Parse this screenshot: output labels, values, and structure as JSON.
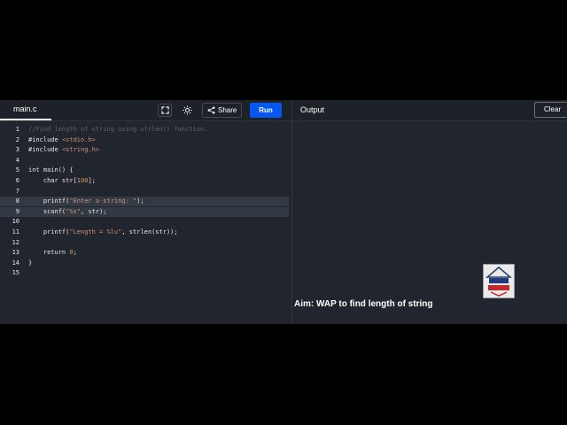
{
  "editor": {
    "file_tab": "main.c",
    "lines": [
      {
        "n": "1",
        "text": "//Find length of string using strlen() function."
      },
      {
        "n": "2",
        "text": "#include <stdio.h>"
      },
      {
        "n": "3",
        "text": "#include <string.h>"
      },
      {
        "n": "4",
        "text": ""
      },
      {
        "n": "5",
        "text": "int main() {"
      },
      {
        "n": "6",
        "text": "    char str[100];"
      },
      {
        "n": "7",
        "text": ""
      },
      {
        "n": "8",
        "text": "    printf(\"Enter a string: \");"
      },
      {
        "n": "9",
        "text": "    scanf(\"%s\", str);"
      },
      {
        "n": "10",
        "text": ""
      },
      {
        "n": "11",
        "text": "    printf(\"Length = %lu\", strlen(str));"
      },
      {
        "n": "12",
        "text": ""
      },
      {
        "n": "13",
        "text": "    return 0;"
      },
      {
        "n": "14",
        "text": "}"
      },
      {
        "n": "15",
        "text": ""
      }
    ]
  },
  "toolbar": {
    "fullscreen_icon": "fullscreen-icon",
    "theme_icon": "sun-icon",
    "share_icon": "share-icon",
    "share_label": "Share",
    "run_label": "Run"
  },
  "output": {
    "title": "Output",
    "clear_label": "Clear"
  },
  "overlay": {
    "aim_text": "Aim: WAP to find length of string",
    "logo_lettering": "VIER"
  },
  "colors": {
    "accent": "#0556f3",
    "background": "#21252d",
    "comment": "#5c6370",
    "string": "#ce9178",
    "number": "#d19a66"
  }
}
